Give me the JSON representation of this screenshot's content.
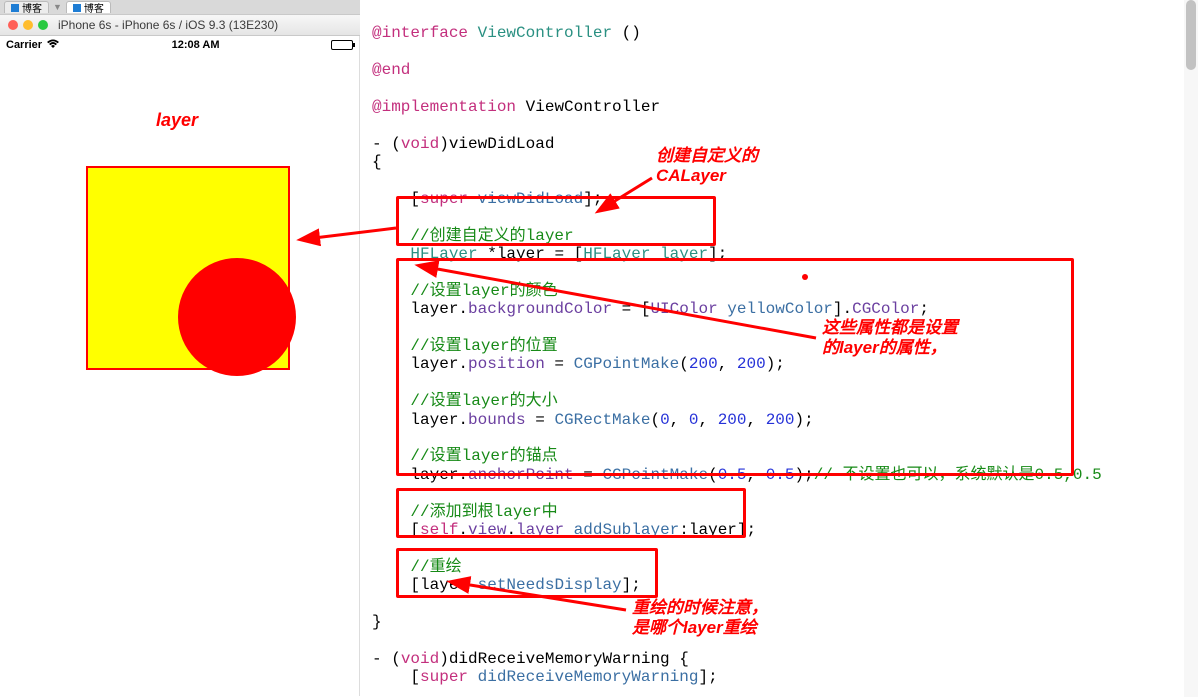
{
  "tabs": {
    "tab1_label": "博客",
    "arrow": "▼",
    "tab2_label": "博客"
  },
  "simbar": {
    "title": "iPhone 6s - iPhone 6s / iOS 9.3 (13E230)"
  },
  "statusbar": {
    "carrier": "Carrier",
    "wifi_glyph": "᯾",
    "time": "12:08 AM"
  },
  "sim": {
    "layer_label": "layer"
  },
  "annotations": {
    "a1_l1": "创建自定义的",
    "a1_l2": "CALayer",
    "a2_l1": "这些属性都是设置",
    "a2_l2": "的layer的属性，",
    "a3_l1": "重绘的时候注意，",
    "a3_l2": "是哪个layer重绘"
  },
  "code": {
    "l1_kw": "@interface",
    "l1_type": "ViewController",
    "l1_paren": " ()",
    "l2_kw": "@end",
    "l3_kw": "@implementation",
    "l3_type": " ViewController",
    "l4_p1": "- (",
    "l4_kw": "void",
    "l4_p2": ")viewDidLoad",
    "l5": "{",
    "l6_p1": "    [",
    "l6_kw": "super",
    "l6_msg": " viewDidLoad",
    "l6_p2": "];",
    "l7_cmt": "    //创建自定义的layer",
    "l8_p1": "    ",
    "l8_type1": "HFLayer",
    "l8_p2": " *layer = [",
    "l8_type2": "HFLayer",
    "l8_msg": " layer",
    "l8_p3": "];",
    "l9_cmt": "    //设置layer的颜色",
    "l10_p1": "    layer.",
    "l10_prop": "backgroundColor",
    "l10_p2": " = [",
    "l10_type": "UIColor",
    "l10_msg": " yellowColor",
    "l10_p3": "].",
    "l10_prop2": "CGColor",
    "l10_p4": ";",
    "l11_cmt": "    //设置layer的位置",
    "l12_p1": "    layer.",
    "l12_prop": "position",
    "l12_p2": " = ",
    "l12_fn": "CGPointMake",
    "l12_p3": "(",
    "l12_n1": "200",
    "l12_p4": ", ",
    "l12_n2": "200",
    "l12_p5": ");",
    "l13_cmt": "    //设置layer的大小",
    "l14_p1": "    layer.",
    "l14_prop": "bounds",
    "l14_p2": " = ",
    "l14_fn": "CGRectMake",
    "l14_p3": "(",
    "l14_n1": "0",
    "l14_p4": ", ",
    "l14_n2": "0",
    "l14_p5": ", ",
    "l14_n3": "200",
    "l14_p6": ", ",
    "l14_n4": "200",
    "l14_p7": ");",
    "l15_cmt": "    //设置layer的锚点",
    "l16_p1": "    layer.",
    "l16_prop": "anchorPoint",
    "l16_p2": " = ",
    "l16_fn": "CGPointMake",
    "l16_p3": "(",
    "l16_n1": "0.5",
    "l16_p4": ", ",
    "l16_n2": "0.5",
    "l16_p5": ");",
    "l16_cmt": "// 不设置也可以，系统默认是0.5,0.5",
    "l17_cmt": "    //添加到根layer中",
    "l18_p1": "    [",
    "l18_kw": "self",
    "l18_p2": ".",
    "l18_prop1": "view",
    "l18_p3": ".",
    "l18_prop2": "layer",
    "l18_msg": " addSublayer",
    "l18_p4": ":layer];",
    "l19_cmt": "    //重绘",
    "l20_p1": "    [layer ",
    "l20_msg": "setNeedsDisplay",
    "l20_p2": "];",
    "l21": "}",
    "l22_p1": "- (",
    "l22_kw": "void",
    "l22_p2": ")didReceiveMemoryWarning {",
    "l23_p1": "    [",
    "l23_kw": "super",
    "l23_msg": " didReceiveMemoryWarning",
    "l23_p2": "];"
  }
}
